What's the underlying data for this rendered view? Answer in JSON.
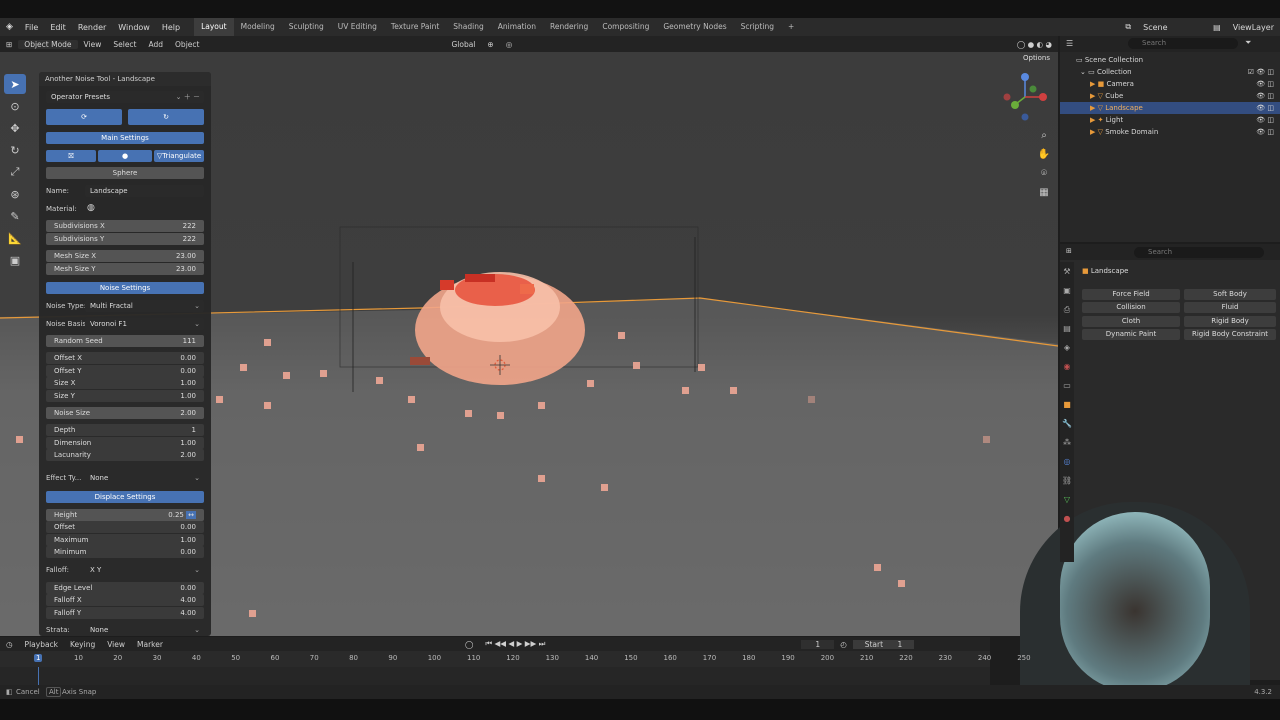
{
  "menu": {
    "items": [
      "File",
      "Edit",
      "Render",
      "Window",
      "Help"
    ],
    "workspaces": [
      "Layout",
      "Modeling",
      "Sculpting",
      "UV Editing",
      "Texture Paint",
      "Shading",
      "Animation",
      "Rendering",
      "Compositing",
      "Geometry Nodes",
      "Scripting"
    ],
    "active_workspace": "Layout",
    "add_tab": "+"
  },
  "header": {
    "mode": "Object Mode",
    "view": "View",
    "select": "Select",
    "add": "Add",
    "object": "Object",
    "transform": "Global",
    "options": "Options",
    "scene": "Scene",
    "viewlayer": "ViewLayer"
  },
  "panel": {
    "title": "Another Noise Tool - Landscape",
    "presets": "Operator Presets",
    "main_settings": "Main Settings",
    "triangulate": "Triangulate",
    "sphere": "Sphere",
    "name_label": "Name:",
    "name_value": "Landscape",
    "material_label": "Material:",
    "subdiv_x_label": "Subdivisions X",
    "subdiv_x": "222",
    "subdiv_y_label": "Subdivisions Y",
    "subdiv_y": "222",
    "mesh_x_label": "Mesh Size X",
    "mesh_x": "23.00",
    "mesh_y_label": "Mesh Size Y",
    "mesh_y": "23.00",
    "noise_settings": "Noise Settings",
    "noise_type_label": "Noise Type:",
    "noise_type": "Multi Fractal",
    "noise_basis_label": "Noise Basis:",
    "noise_basis": "Voronoi F1",
    "random_seed_label": "Random Seed",
    "random_seed": "111",
    "offset_x_label": "Offset X",
    "offset_x": "0.00",
    "offset_y_label": "Offset Y",
    "offset_y": "0.00",
    "size_x_label": "Size X",
    "size_x": "1.00",
    "size_y_label": "Size Y",
    "size_y": "1.00",
    "noise_size_label": "Noise Size",
    "noise_size": "2.00",
    "depth_label": "Depth",
    "depth": "1",
    "dimension_label": "Dimension",
    "dimension": "1.00",
    "lacunarity_label": "Lacunarity",
    "lacunarity": "2.00",
    "effect_label": "Effect Ty...",
    "effect": "None",
    "displace_settings": "Displace Settings",
    "height_label": "Height",
    "height": "0.25",
    "d_offset_label": "Offset",
    "d_offset": "0.00",
    "maximum_label": "Maximum",
    "maximum": "1.00",
    "minimum_label": "Minimum",
    "minimum": "0.00",
    "falloff_label": "Falloff:",
    "falloff": "X Y",
    "edge_level_label": "Edge Level",
    "edge_level": "0.00",
    "falloff_x_label": "Falloff X",
    "falloff_x": "4.00",
    "falloff_y_label": "Falloff Y",
    "falloff_y": "4.00",
    "strata_label": "Strata:",
    "strata": "None"
  },
  "outliner": {
    "search_placeholder": "Search",
    "scene_collection": "Scene Collection",
    "collection": "Collection",
    "items": [
      {
        "name": "Camera"
      },
      {
        "name": "Cube"
      },
      {
        "name": "Landscape"
      },
      {
        "name": "Light"
      },
      {
        "name": "Smoke Domain"
      }
    ]
  },
  "properties": {
    "search_placeholder": "Search",
    "object_name": "Landscape",
    "physics": [
      "Force Field",
      "Soft Body",
      "Collision",
      "Fluid",
      "Cloth",
      "Rigid Body",
      "Dynamic Paint",
      "Rigid Body Constraint"
    ]
  },
  "timeline": {
    "playback": "Playback",
    "keying": "Keying",
    "view": "View",
    "marker": "Marker",
    "current_frame": "1",
    "start_label": "Start",
    "start": "1",
    "ticks": [
      "1",
      "10",
      "20",
      "30",
      "40",
      "50",
      "60",
      "70",
      "80",
      "90",
      "100",
      "110",
      "120",
      "130",
      "140",
      "150",
      "160",
      "170",
      "180",
      "190",
      "200",
      "210",
      "220",
      "230",
      "240",
      "250"
    ]
  },
  "status": {
    "cancel": "Cancel",
    "alt_key": "Alt",
    "axis_snap": "Axis Snap",
    "version": "4.3.2"
  }
}
